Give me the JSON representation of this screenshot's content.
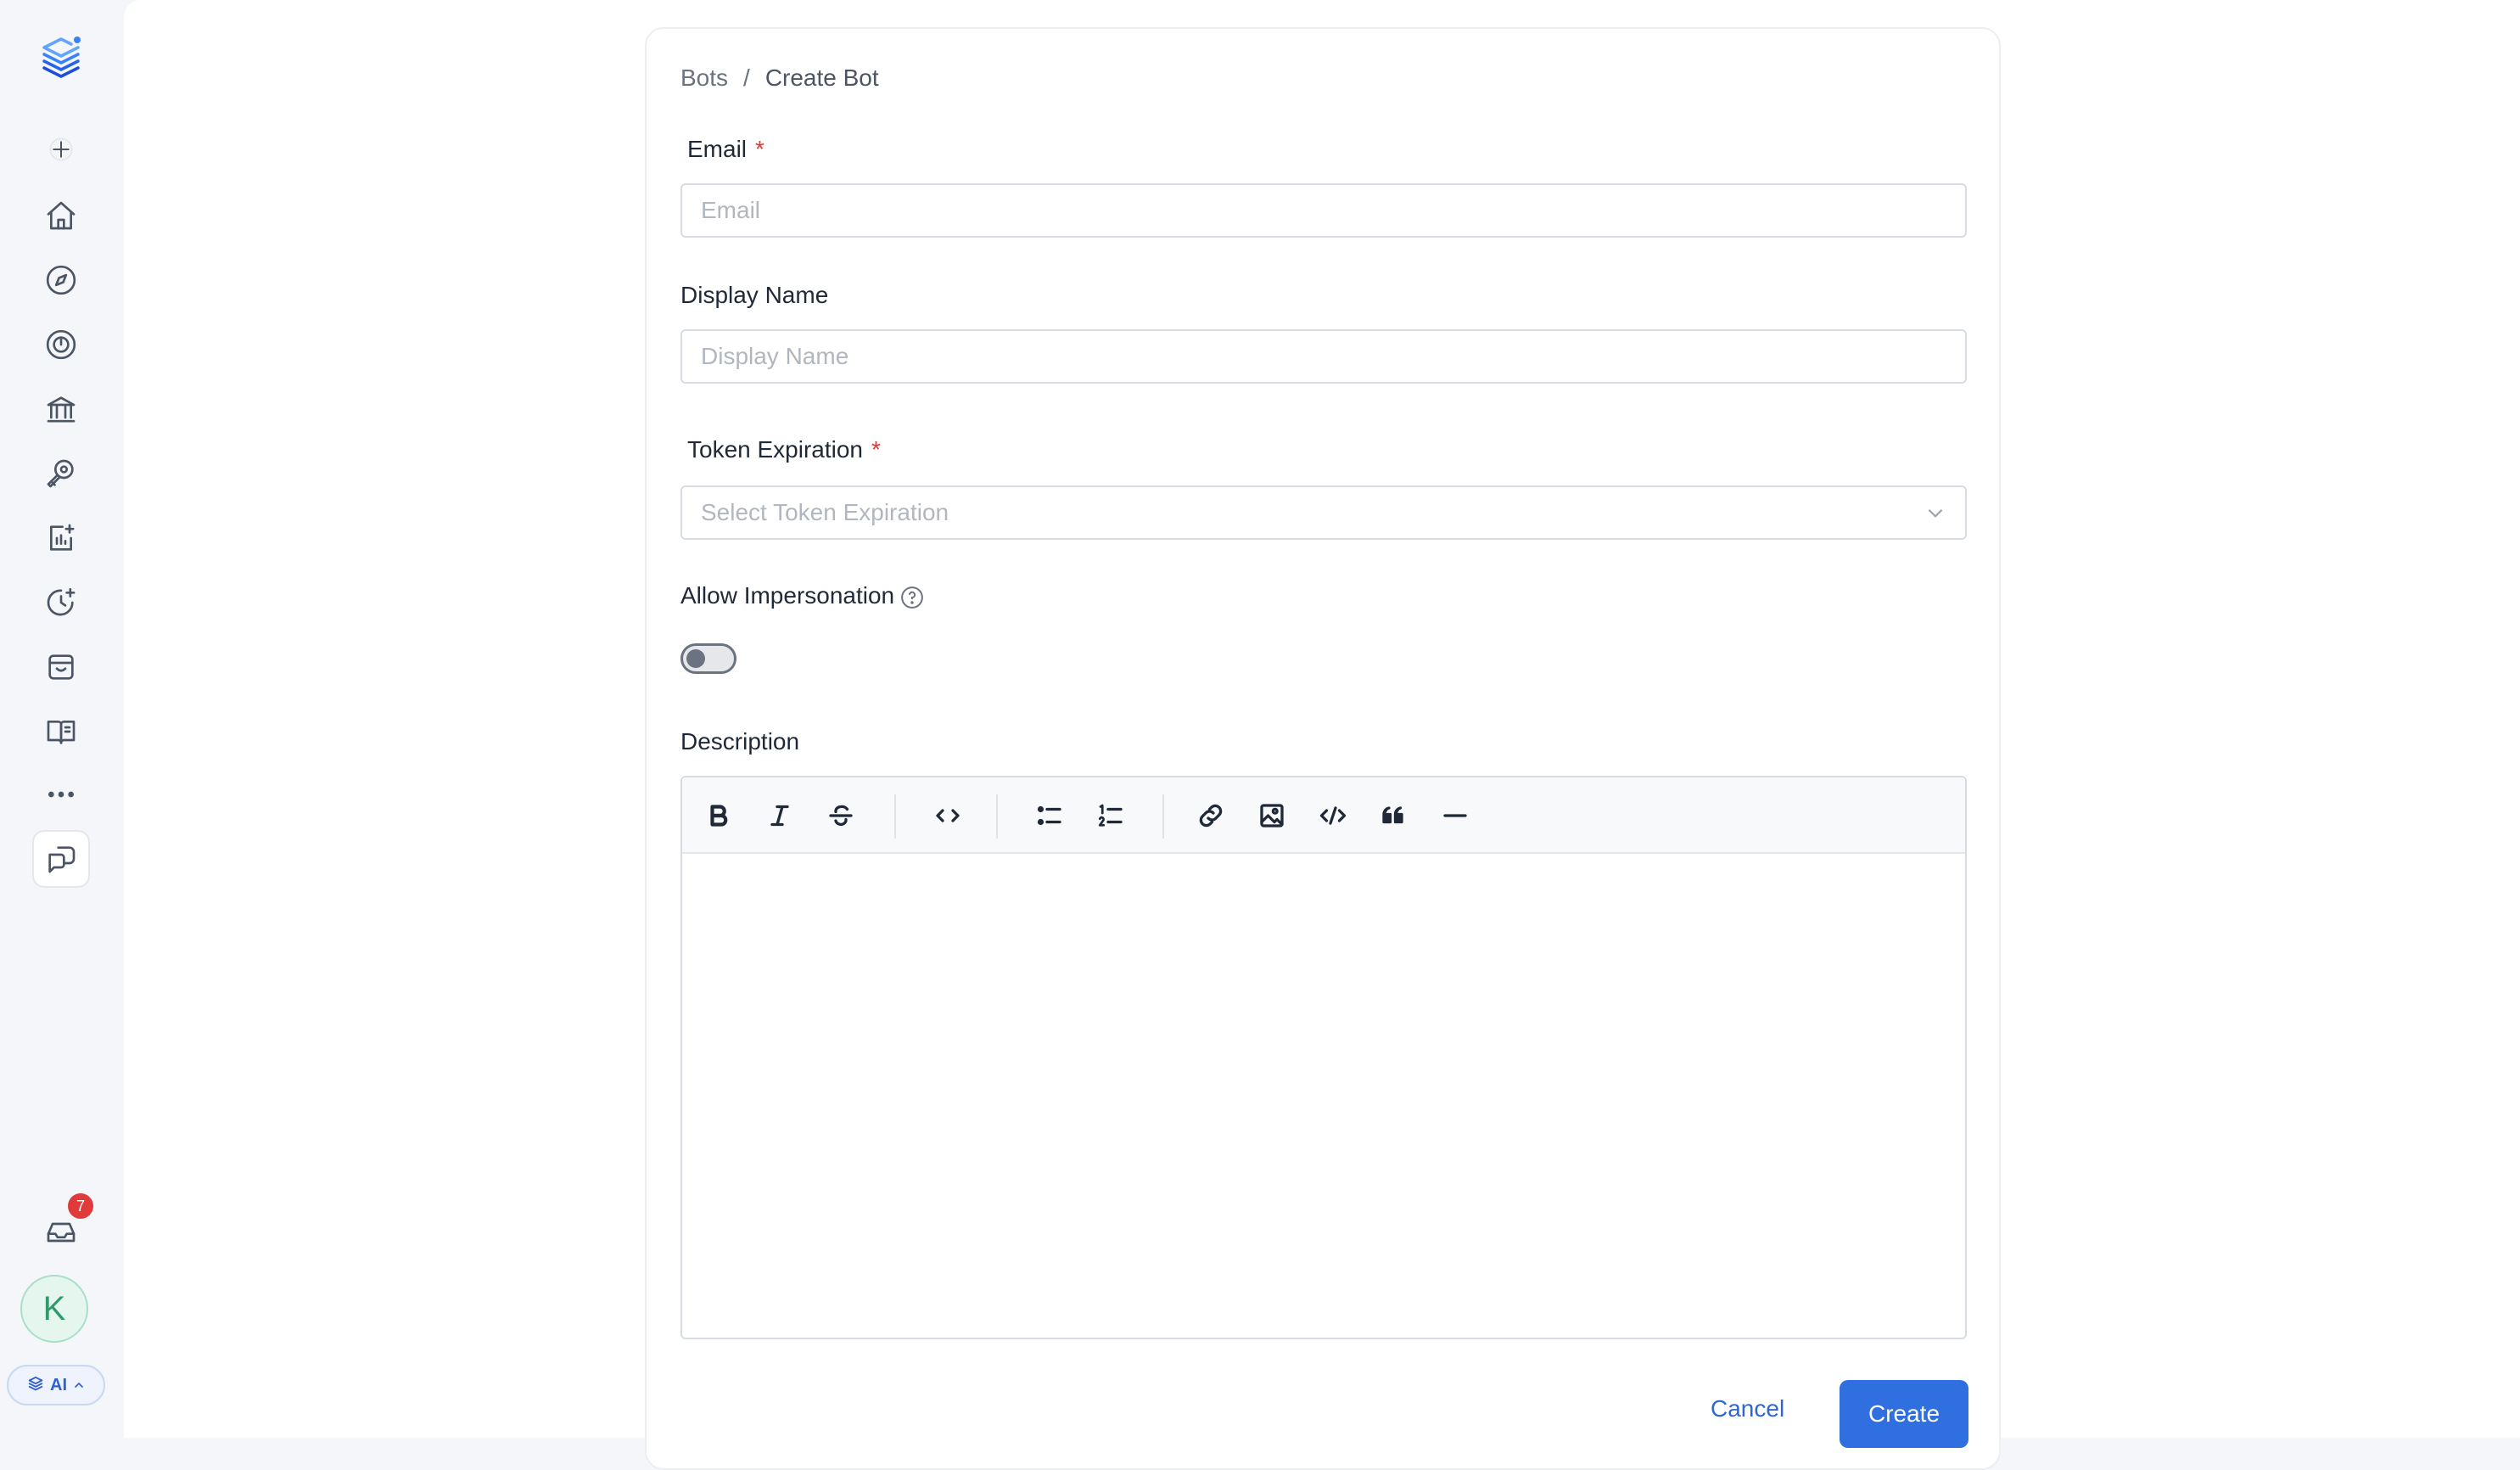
{
  "sidebar": {
    "logo_icon": "stacked-layers-logo",
    "items": [
      {
        "name": "add-icon"
      },
      {
        "name": "home-icon"
      },
      {
        "name": "explore-icon"
      },
      {
        "name": "observability-icon"
      },
      {
        "name": "governance-icon"
      },
      {
        "name": "insights-icon"
      },
      {
        "name": "data-quality-icon"
      },
      {
        "name": "incident-icon"
      },
      {
        "name": "marketplace-icon"
      },
      {
        "name": "glossary-icon"
      },
      {
        "name": "more-icon"
      },
      {
        "name": "chat-icon"
      }
    ],
    "inbox_badge": "7",
    "avatar_initial": "K",
    "ai_label": "AI"
  },
  "breadcrumb": {
    "parent": "Bots",
    "separator": "/",
    "current": "Create Bot"
  },
  "form": {
    "email": {
      "label": "Email",
      "required_mark": "*",
      "value": "",
      "placeholder": "Email"
    },
    "display_name": {
      "label": "Display Name",
      "value": "",
      "placeholder": "Display Name"
    },
    "token_expiration": {
      "label": "Token Expiration",
      "required_mark": "*",
      "placeholder": "Select Token Expiration",
      "selected": ""
    },
    "allow_impersonation": {
      "label": "Allow Impersonation",
      "enabled": false
    },
    "description": {
      "label": "Description",
      "value": "",
      "toolbar": [
        "bold",
        "italic",
        "strikethrough",
        "inline-code",
        "bullet-list",
        "ordered-list",
        "link",
        "image",
        "code-block",
        "quote",
        "horizontal-rule"
      ]
    }
  },
  "actions": {
    "cancel_label": "Cancel",
    "create_label": "Create"
  },
  "colors": {
    "primary": "#2f6fe0",
    "link": "#2f66d6",
    "required": "#d83b3b",
    "badge": "#e03a3a",
    "avatar_bg": "#e4f6ee",
    "avatar_text": "#2e9a6b"
  }
}
